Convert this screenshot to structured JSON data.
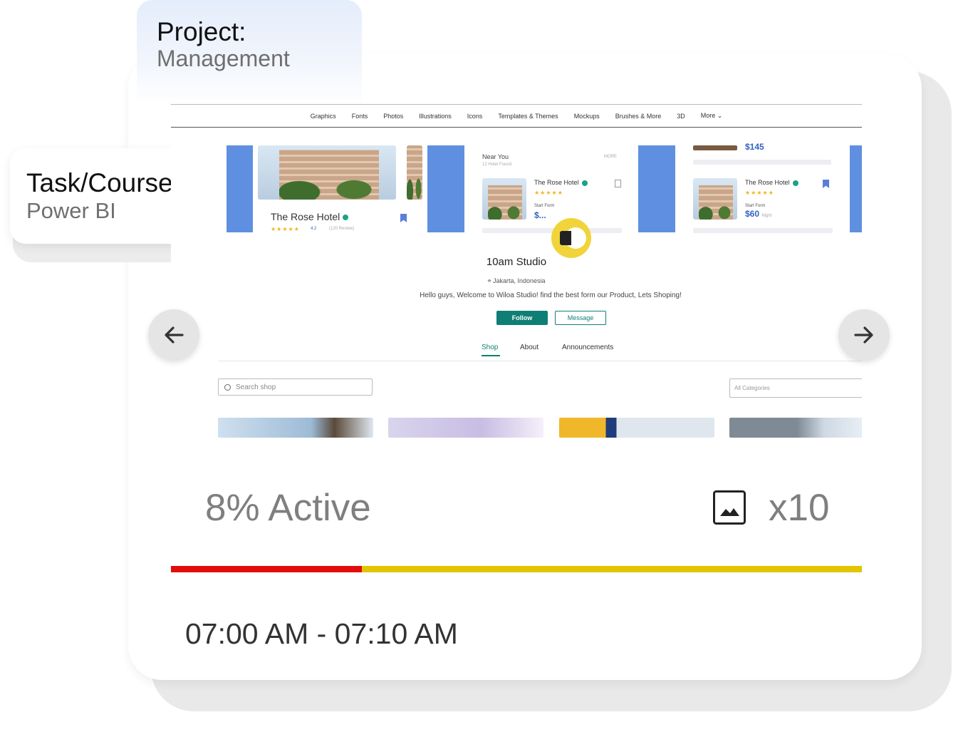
{
  "project": {
    "label": "Project:",
    "value": "Management"
  },
  "task": {
    "label": "Task/Course:",
    "value": "Power BI"
  },
  "screenshot": {
    "nav": [
      "Graphics",
      "Fonts",
      "Photos",
      "Illustrations",
      "Icons",
      "Templates & Themes",
      "Mockups",
      "Brushes & More",
      "3D",
      "More ⌄"
    ],
    "featured_hotel": {
      "name": "The Rose Hotel",
      "rating": "4.2",
      "reviews": "(120 Review)"
    },
    "near_you": {
      "title": "Near You",
      "subtitle": "12 Hotel Found",
      "more": "MORE"
    },
    "listing_1": {
      "name": "The Rose Hotel",
      "start_from": "Start Form",
      "price": "$..."
    },
    "listing_2": {
      "name": "The Rose Hotel",
      "start_from": "Start Form",
      "price": "$60",
      "per": "Night",
      "top_price": "$145"
    },
    "studio": {
      "name": "10am Studio",
      "location": "Jakarta, Indonesia",
      "welcome": "Hello guys, Welcome to Wiloa Studio! find the best form our Product, Lets Shoping!",
      "follow": "Follow",
      "message": "Message"
    },
    "tabs": [
      "Shop",
      "About",
      "Announcements"
    ],
    "search_placeholder": "Search shop",
    "category_placeholder": "All Categories"
  },
  "stats": {
    "active": "8% Active",
    "count": "x10",
    "progress_fraction": 0.08
  },
  "time_range": "07:00 AM - 07:10 AM",
  "colors": {
    "accent_teal": "#0f7f75",
    "progress_red": "#e00d0d",
    "progress_yellow": "#e2c500",
    "blue_block": "#5f8fe0",
    "logo_yellow": "#f1d43a"
  },
  "icons": {
    "prev": "arrow-left-icon",
    "next": "arrow-right-icon",
    "image": "image-icon",
    "search": "search-icon"
  }
}
